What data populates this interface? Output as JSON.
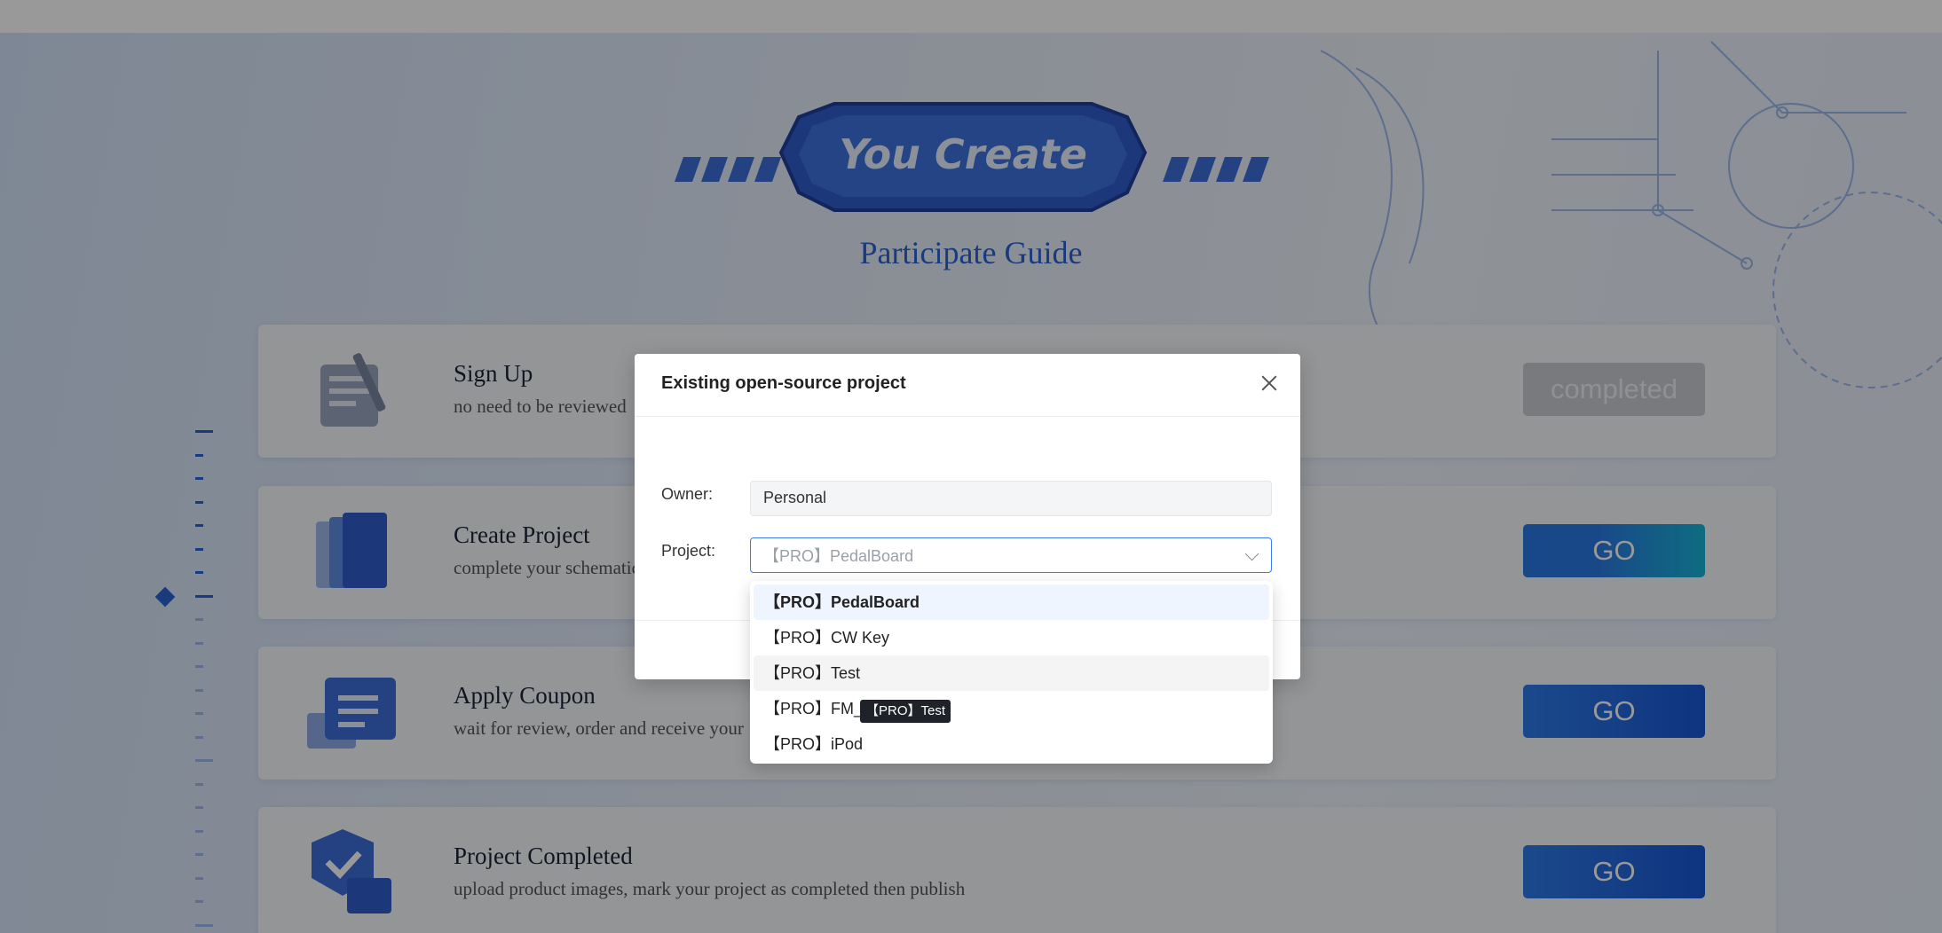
{
  "hero": {
    "logo_text": "You Create",
    "guide_title": "Participate Guide"
  },
  "steps": [
    {
      "title": "Sign Up",
      "desc": "no need to be reviewed",
      "button": "completed",
      "icon": "pen-paper-icon"
    },
    {
      "title": "Create Project",
      "desc": "complete your schematic",
      "button": "GO",
      "icon": "layers-icon"
    },
    {
      "title": "Apply Coupon",
      "desc": "wait for review, order and receive your",
      "button": "GO",
      "icon": "coupon-icon"
    },
    {
      "title": "Project Completed",
      "desc": "upload product images, mark your project as completed then publish",
      "button": "GO",
      "icon": "badge-image-icon"
    }
  ],
  "modal": {
    "title": "Existing open-source project",
    "owner_label": "Owner:",
    "owner_value": "Personal",
    "project_label": "Project:",
    "project_value": "【PRO】PedalBoard"
  },
  "dropdown": {
    "options": [
      "【PRO】PedalBoard",
      "【PRO】CW Key",
      "【PRO】Test",
      "【PRO】FM_",
      "【PRO】iPod"
    ],
    "selected_index": 0,
    "hover_index": 2
  },
  "tooltip": "【PRO】Test",
  "colors": {
    "accent": "#2b62d0",
    "go_button": "#1858d6",
    "completed_button": "#c9ccd2"
  }
}
